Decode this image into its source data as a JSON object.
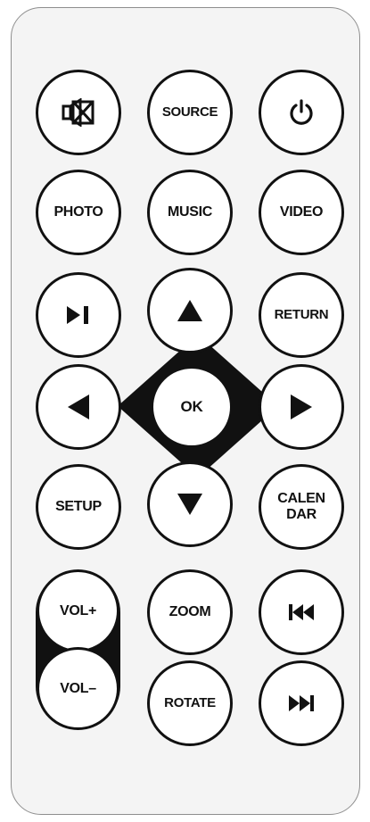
{
  "buttons": {
    "mute": {
      "icon": "mute-icon"
    },
    "source": {
      "label": "SOURCE"
    },
    "power": {
      "icon": "power-icon"
    },
    "photo": {
      "label": "PHOTO"
    },
    "music": {
      "label": "MUSIC"
    },
    "video": {
      "label": "VIDEO"
    },
    "play_pause": {
      "icon": "play-pause-icon"
    },
    "up": {
      "icon": "arrow-up-icon"
    },
    "return": {
      "label": "RETURN"
    },
    "left": {
      "icon": "arrow-left-icon"
    },
    "ok": {
      "label": "OK"
    },
    "right": {
      "icon": "arrow-right-icon"
    },
    "setup": {
      "label": "SETUP"
    },
    "down": {
      "icon": "arrow-down-icon"
    },
    "calendar": {
      "label_line1": "CALEN",
      "label_line2": "DAR"
    },
    "vol_up": {
      "label": "VOL+"
    },
    "zoom": {
      "label": "ZOOM"
    },
    "prev": {
      "icon": "skip-previous-icon"
    },
    "vol_down": {
      "label": "VOL–"
    },
    "rotate": {
      "label": "ROTATE"
    },
    "next": {
      "icon": "skip-next-icon"
    }
  },
  "colors": {
    "body": "#f4f4f4",
    "outline": "#111111",
    "button_face": "#ffffff"
  }
}
